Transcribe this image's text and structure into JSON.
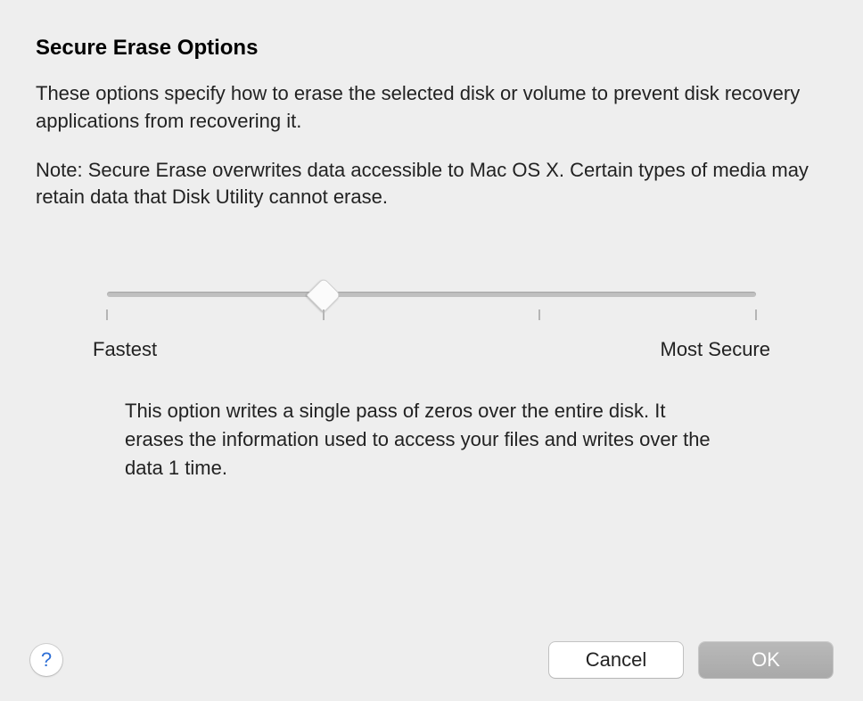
{
  "dialog": {
    "title": "Secure Erase Options",
    "description_1": "These options specify how to erase the selected disk or volume to prevent disk recovery applications from recovering it.",
    "description_2": "Note: Secure Erase overwrites data accessible to Mac OS X.  Certain types of media may retain data that Disk Utility cannot erase."
  },
  "slider": {
    "min_label": "Fastest",
    "max_label": "Most Secure",
    "stops": 4,
    "value_index": 1,
    "explanation": "This option writes a single pass of zeros over the entire disk. It erases the information used to access your files and writes over the data 1 time."
  },
  "buttons": {
    "help": "?",
    "cancel": "Cancel",
    "ok": "OK"
  }
}
